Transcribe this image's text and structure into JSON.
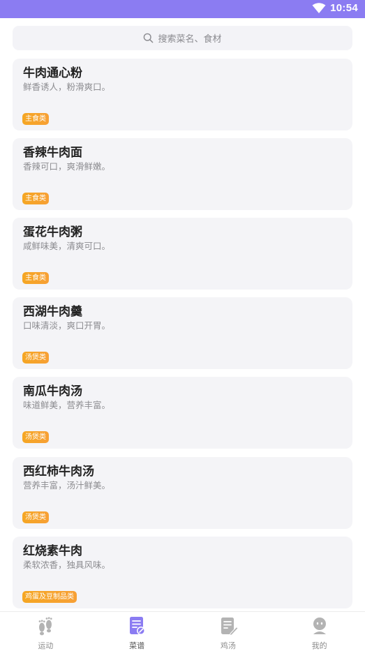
{
  "status_bar": {
    "time": "10:54"
  },
  "search": {
    "placeholder": "搜索菜名、食材"
  },
  "recipes": [
    {
      "title": "牛肉通心粉",
      "desc": "鲜香诱人，粉滑爽口。",
      "tag": "主食类"
    },
    {
      "title": "香辣牛肉面",
      "desc": "香辣可口，爽滑鲜嫩。",
      "tag": "主食类"
    },
    {
      "title": "蛋花牛肉粥",
      "desc": "咸鲜味美，清爽可口。",
      "tag": "主食类"
    },
    {
      "title": "西湖牛肉羹",
      "desc": "口味清淡，爽口开胃。",
      "tag": "汤煲类"
    },
    {
      "title": "南瓜牛肉汤",
      "desc": "味道鲜美，营养丰富。",
      "tag": "汤煲类"
    },
    {
      "title": "西红柿牛肉汤",
      "desc": "营养丰富，汤汁鲜美。",
      "tag": "汤煲类"
    },
    {
      "title": "红烧素牛肉",
      "desc": "柔软浓香，独具风味。",
      "tag": "鸡蛋及豆制品类"
    }
  ],
  "tabs": [
    {
      "label": "运动",
      "icon": "footprints-icon"
    },
    {
      "label": "菜谱",
      "icon": "recipe-book-icon",
      "active": true
    },
    {
      "label": "鸡汤",
      "icon": "article-edit-icon"
    },
    {
      "label": "我的",
      "icon": "profile-icon"
    }
  ],
  "colors": {
    "accent": "#8b7cf2",
    "tag": "#f5a623",
    "card": "#f4f4f7"
  }
}
